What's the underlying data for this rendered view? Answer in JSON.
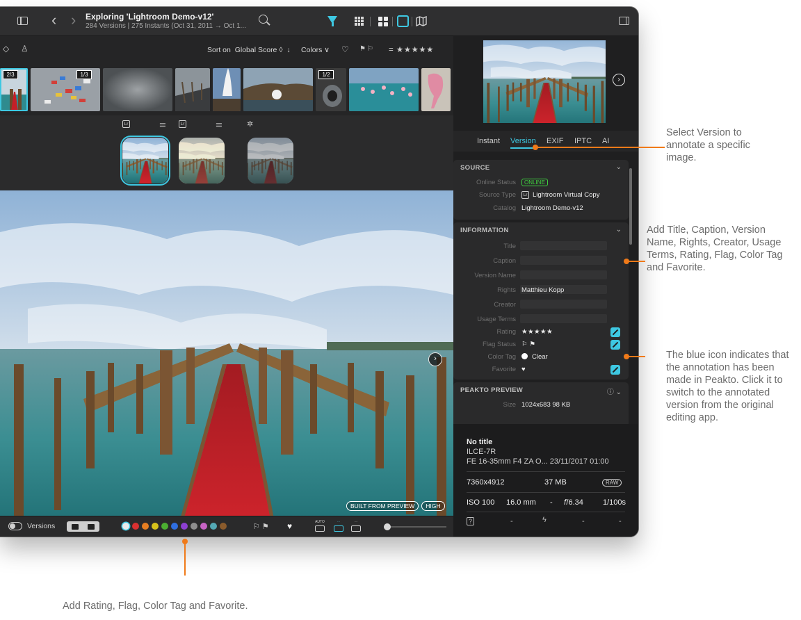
{
  "toolbar": {
    "title": "Exploring 'Lightroom Demo-v12'",
    "subtitle": "284 Versions | 275 Instants (Oct 31, 2011 → Oct 1..."
  },
  "filmstrip": {
    "sort_label": "Sort on",
    "sort_value": "Global Score ◊",
    "colors_label": "Colors ∨",
    "rating": "= ★★★★★",
    "badges": [
      "2/3",
      "1/3",
      "1/2"
    ]
  },
  "versions": {
    "lr_badge": "Lr"
  },
  "main_image": {
    "badges": [
      "BUILT FROM PREVIEW",
      "HIGH"
    ]
  },
  "bottombar": {
    "versions_label": "Versions",
    "color_tags": [
      "#e9e9e9",
      "#d93030",
      "#e67e22",
      "#d7c21b",
      "#4cae31",
      "#2f6ee0",
      "#8c3fd1",
      "#8e8e8e",
      "#c763c4",
      "#53a8b5",
      "#8a5b2c"
    ],
    "crop_auto": "AUTO"
  },
  "right_panel": {
    "tabs": [
      "Instant",
      "Version",
      "EXIF",
      "IPTC",
      "AI"
    ],
    "active_tab": "Version",
    "source": {
      "title": "SOURCE",
      "online_label": "Online Status",
      "online_value": "ONLINE",
      "type_label": "Source Type",
      "type_value": "Lightroom Virtual Copy",
      "catalog_label": "Catalog",
      "catalog_value": "Lightroom Demo-v12"
    },
    "information": {
      "title": "INFORMATION",
      "title_label": "Title",
      "caption_label": "Caption",
      "version_name_label": "Version Name",
      "rights_label": "Rights",
      "rights_value": "Matthieu Kopp",
      "creator_label": "Creator",
      "usage_label": "Usage Terms",
      "rating_label": "Rating",
      "rating_value": "★★★★★",
      "flag_label": "Flag Status",
      "color_label": "Color Tag",
      "color_value": "Clear",
      "favorite_label": "Favorite"
    },
    "preview": {
      "title": "PEAKTO PREVIEW",
      "size_label": "Size",
      "size_value": "1024x683  98 KB"
    },
    "info": {
      "title": "No title",
      "camera": "ILCE-7R",
      "lens_date": "FE 16-35mm F4 ZA O...  23/11/2017 01:00",
      "dimensions": "7360x4912",
      "filesize": "37 MB",
      "raw": "RAW",
      "iso": "ISO 100",
      "focal": "16.0 mm",
      "dash": "-",
      "aperture": "𝑓/6.34",
      "shutter": "1/100s"
    }
  },
  "callouts": {
    "version": "Select Version to annotate a specific image.",
    "info": "Add Title, Caption, Version Name, Rights, Creator, Usage Terms, Rating, Flag, Color Tag and Favorite.",
    "blue_icon": "The blue icon indicates that the annotation has been made in Peakto. Click it to switch to the annotated version from the original editing app.",
    "bottom": "Add Rating, Flag, Color Tag and Favorite."
  }
}
